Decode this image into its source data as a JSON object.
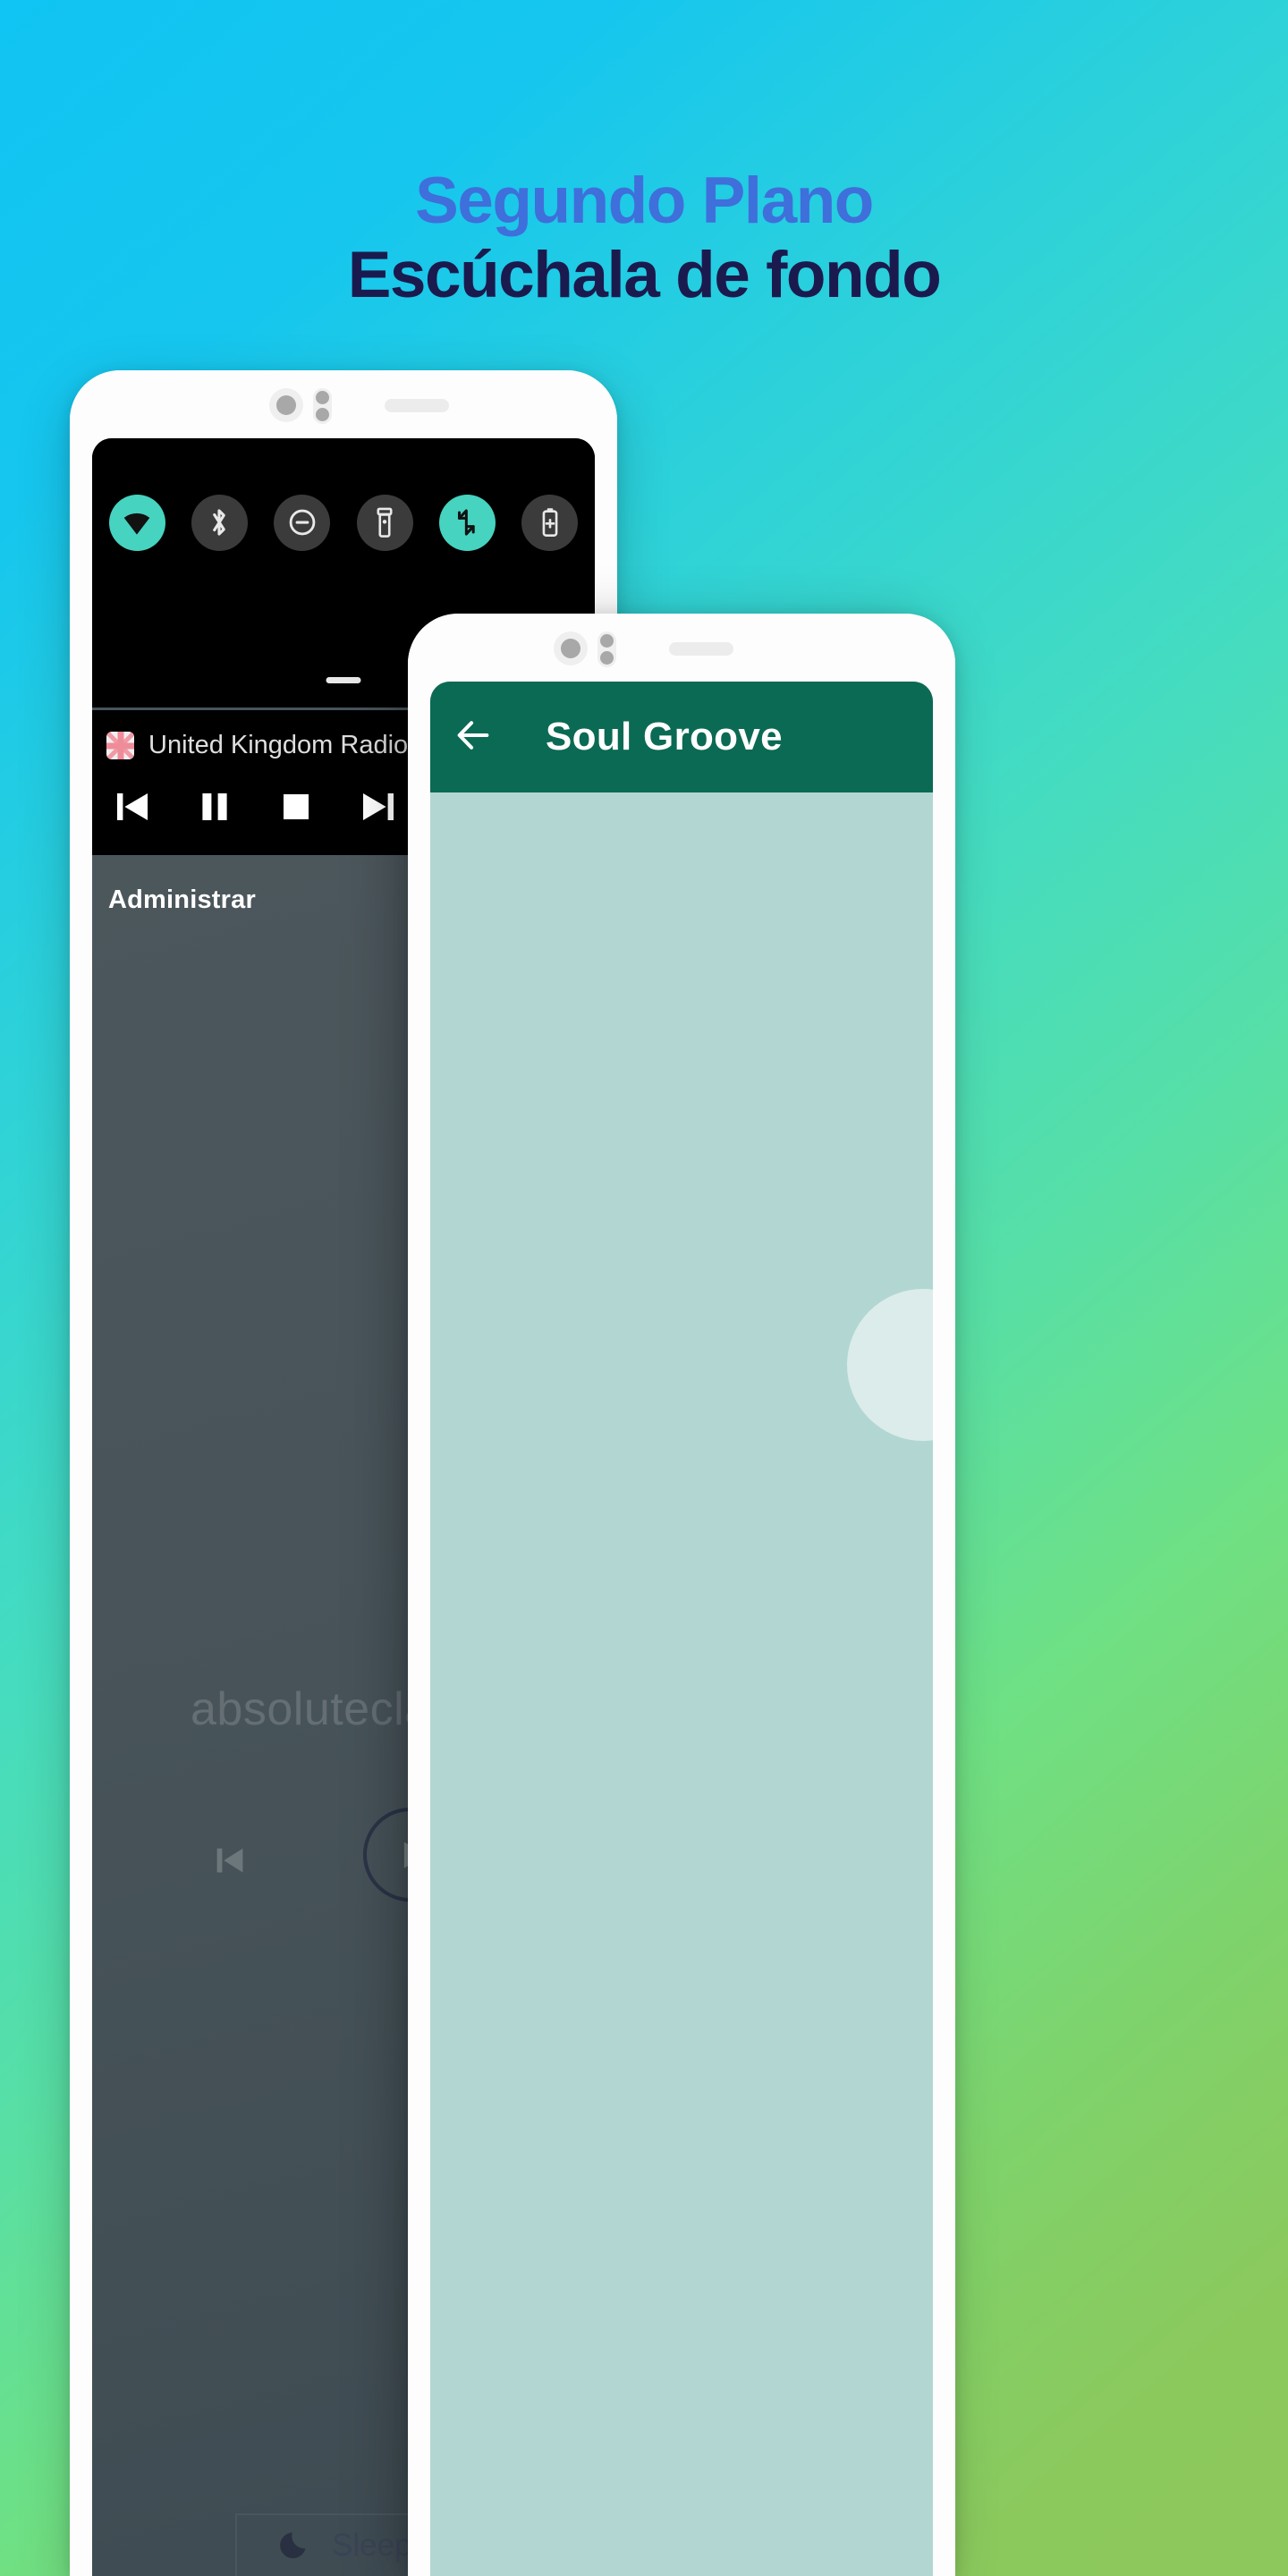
{
  "background": {
    "gradient_from": "#10c4f3",
    "gradient_mid": "#4fdbb4",
    "gradient_to": "#8dc85c"
  },
  "headline": {
    "line1": "Segundo Plano",
    "line2": "Escúchala de fondo",
    "line1_color": "#3f6fdb",
    "line2_color": "#1b1a4e"
  },
  "phone_back": {
    "quick_settings": {
      "tiles": [
        {
          "icon": "wifi-icon",
          "label": "Wi-Fi",
          "active": true
        },
        {
          "icon": "bluetooth-icon",
          "label": "Bluetooth",
          "active": false
        },
        {
          "icon": "do-not-disturb-icon",
          "label": "No molestar",
          "active": false
        },
        {
          "icon": "flashlight-icon",
          "label": "Linterna",
          "active": false
        },
        {
          "icon": "auto-rotate-icon",
          "label": "Rotación automática",
          "active": true
        },
        {
          "icon": "battery-saver-icon",
          "label": "Ahorro de batería",
          "active": false
        }
      ],
      "active_color": "#46d3c0",
      "inactive_color": "#3b3b3b",
      "panel_color": "#000000"
    },
    "media_notification": {
      "app_icon": "uk-flag-icon",
      "title": "United Kingdom Radio",
      "controls": [
        {
          "icon": "previous-track-icon",
          "label": "Anterior"
        },
        {
          "icon": "pause-icon",
          "label": "Pausa"
        },
        {
          "icon": "stop-icon",
          "label": "Detener"
        },
        {
          "icon": "next-track-icon",
          "label": "Siguiente"
        }
      ]
    },
    "app_screen": {
      "section_label": "Administrar",
      "watermark_icon": "music-note-icon",
      "station_name": "absoluteclass",
      "player": {
        "previous_icon": "previous-track-icon",
        "play_icon": "play-icon"
      },
      "sleep_timer": {
        "icon": "moon-icon",
        "label": "Sleep tim"
      },
      "background_color": "#48545a"
    }
  },
  "phone_front": {
    "appbar": {
      "back_icon": "back-arrow-icon",
      "title": "Soul Groove",
      "color": "#0b6a53"
    },
    "body": {
      "background_color": "#b2d7d3",
      "artwork_placeholder": "album-art-circle"
    }
  }
}
